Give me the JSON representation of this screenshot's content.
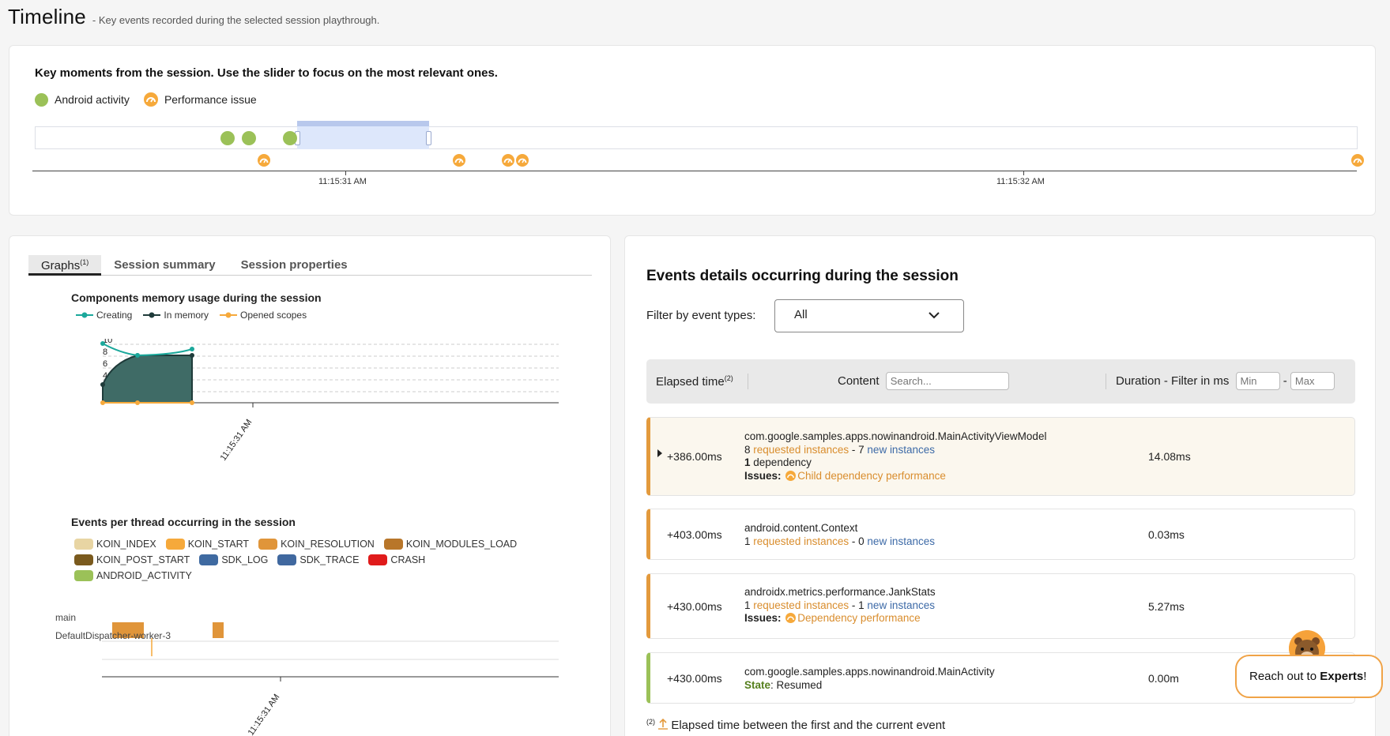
{
  "header": {
    "title": "Timeline",
    "subtitle": "- Key events recorded during the selected session playthrough."
  },
  "timeline": {
    "heading": "Key moments from the session. Use the slider to focus on the most relevant ones.",
    "legend": {
      "android_activity": "Android activity",
      "performance_issue": "Performance issue"
    },
    "tick_labels": [
      "11:15:31 AM",
      "11:15:32 AM"
    ]
  },
  "tabs": [
    {
      "label": "Graphs",
      "sup": "(1)"
    },
    {
      "label": "Session summary"
    },
    {
      "label": "Session properties"
    }
  ],
  "memory_chart": {
    "title": "Components memory usage during the session",
    "legend": [
      "Creating",
      "In memory",
      "Opened scopes"
    ],
    "y_ticks": [
      "10",
      "8",
      "6",
      "4",
      "2",
      "0"
    ],
    "x_tick": "11:15:31 AM"
  },
  "thread_chart": {
    "title": "Events per thread occurring in the session",
    "legend": [
      {
        "label": "KOIN_INDEX",
        "color": "#e8d5a3"
      },
      {
        "label": "KOIN_START",
        "color": "#f6a93b"
      },
      {
        "label": "KOIN_RESOLUTION",
        "color": "#e0953a"
      },
      {
        "label": "KOIN_MODULES_LOAD",
        "color": "#b8762a"
      },
      {
        "label": "KOIN_POST_START",
        "color": "#7a5a1e"
      },
      {
        "label": "SDK_LOG",
        "color": "#3f6aa1"
      },
      {
        "label": "SDK_TRACE",
        "color": "#40689f"
      },
      {
        "label": "CRASH",
        "color": "#e01b1b"
      },
      {
        "label": "ANDROID_ACTIVITY",
        "color": "#9bc158"
      }
    ],
    "threads": [
      "main",
      "DefaultDispatcher-worker-3"
    ],
    "x_tick": "11:15:31 AM"
  },
  "events": {
    "title": "Events details occurring during the session",
    "filter_label": "Filter by event types:",
    "filter_value": "All",
    "columns": {
      "elapsed": "Elapsed time",
      "elapsed_sup": "(2)",
      "content": "Content",
      "search_placeholder": "Search...",
      "duration": "Duration - Filter in ms",
      "min_placeholder": "Min",
      "dash": "-",
      "max_placeholder": "Max"
    },
    "rows": [
      {
        "time": "+386.00ms",
        "name": "com.google.samples.apps.nowinandroid.MainActivityViewModel",
        "requested": "8",
        "requested_label": "requested instances",
        "sep": "-",
        "new": "7",
        "new_label": "new instances",
        "dep_count": "1",
        "dep_label": "dependency",
        "issues_label": "Issues:",
        "issue": "Child dependency performance",
        "duration": "14.08ms"
      },
      {
        "time": "+403.00ms",
        "name": "android.content.Context",
        "requested": "1",
        "requested_label": "requested instances",
        "sep": "-",
        "new": "0",
        "new_label": "new instances",
        "duration": "0.03ms"
      },
      {
        "time": "+430.00ms",
        "name": "androidx.metrics.performance.JankStats",
        "requested": "1",
        "requested_label": "requested instances",
        "sep": "-",
        "new": "1",
        "new_label": "new instances",
        "issues_label": "Issues:",
        "issue": "Dependency performance",
        "duration": "5.27ms"
      },
      {
        "time": "+430.00ms",
        "name": "com.google.samples.apps.nowinandroid.MainActivity",
        "state_label": "State",
        "state": "Resumed",
        "duration": "0.00m"
      }
    ],
    "footnote_sup": "(2)",
    "footnote": "Elapsed time between the first and the current event"
  },
  "experts": {
    "prefix": "Reach out to ",
    "bold": "Experts",
    "suffix": "!"
  }
}
